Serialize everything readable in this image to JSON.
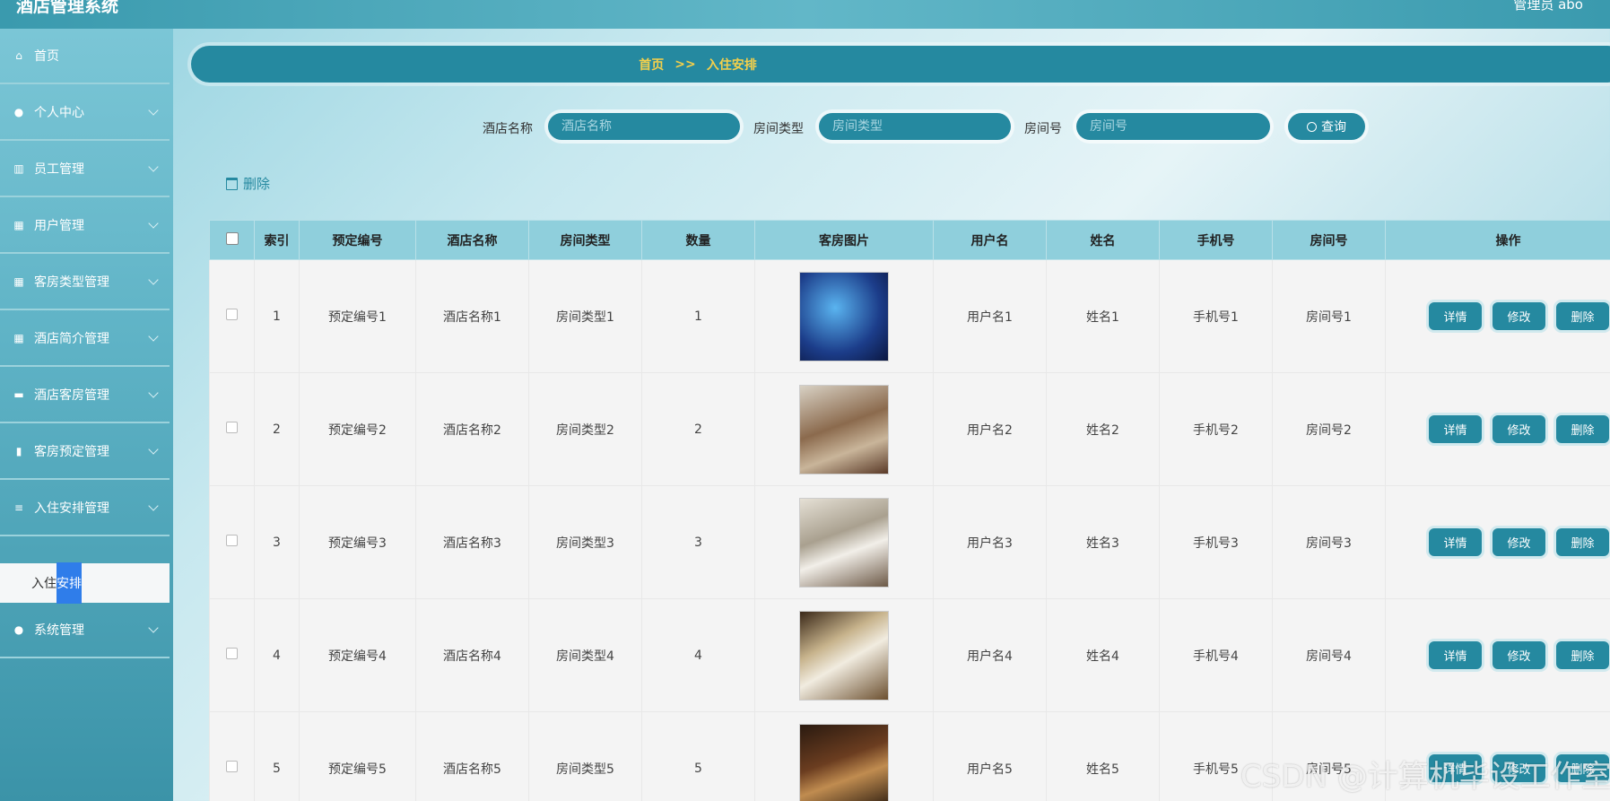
{
  "app": {
    "title": "酒店管理系统",
    "user": "管理员 abo"
  },
  "sidebar": {
    "items": [
      {
        "label": "首页",
        "icon": "home-icon"
      },
      {
        "label": "个人中心",
        "icon": "user-icon"
      },
      {
        "label": "员工管理",
        "icon": "bars-icon"
      },
      {
        "label": "用户管理",
        "icon": "grid-icon"
      },
      {
        "label": "客房类型管理",
        "icon": "grid-icon"
      },
      {
        "label": "酒店简介管理",
        "icon": "grid-icon"
      },
      {
        "label": "酒店客房管理",
        "icon": "comment-icon"
      },
      {
        "label": "客房预定管理",
        "icon": "bar-chart-icon"
      },
      {
        "label": "入住安排管理",
        "icon": "sliders-icon"
      },
      {
        "label": "系统管理",
        "icon": "user-icon"
      }
    ],
    "active_sub": {
      "prefix": "入住",
      "highlight": "安排"
    }
  },
  "breadcrumb": {
    "home": "首页",
    "sep": ">>",
    "current": "入住安排"
  },
  "search": {
    "hotel_label": "酒店名称",
    "hotel_placeholder": "酒店名称",
    "type_label": "房间类型",
    "type_placeholder": "房间类型",
    "room_label": "房间号",
    "room_placeholder": "房间号",
    "button": "查询"
  },
  "toolbar": {
    "delete": "删除"
  },
  "table": {
    "headers": [
      "索引",
      "预定编号",
      "酒店名称",
      "房间类型",
      "数量",
      "客房图片",
      "用户名",
      "姓名",
      "手机号",
      "房间号",
      "操作"
    ],
    "rows": [
      {
        "index": "1",
        "booking_no": "预定编号1",
        "hotel": "酒店名称1",
        "room_type": "房间类型1",
        "qty": "1",
        "username": "用户名1",
        "name": "姓名1",
        "phone": "手机号1",
        "room_no": "房间号1"
      },
      {
        "index": "2",
        "booking_no": "预定编号2",
        "hotel": "酒店名称2",
        "room_type": "房间类型2",
        "qty": "2",
        "username": "用户名2",
        "name": "姓名2",
        "phone": "手机号2",
        "room_no": "房间号2"
      },
      {
        "index": "3",
        "booking_no": "预定编号3",
        "hotel": "酒店名称3",
        "room_type": "房间类型3",
        "qty": "3",
        "username": "用户名3",
        "name": "姓名3",
        "phone": "手机号3",
        "room_no": "房间号3"
      },
      {
        "index": "4",
        "booking_no": "预定编号4",
        "hotel": "酒店名称4",
        "room_type": "房间类型4",
        "qty": "4",
        "username": "用户名4",
        "name": "姓名4",
        "phone": "手机号4",
        "room_no": "房间号4"
      },
      {
        "index": "5",
        "booking_no": "预定编号5",
        "hotel": "酒店名称5",
        "room_type": "房间类型5",
        "qty": "5",
        "username": "用户名5",
        "name": "姓名5",
        "phone": "手机号5",
        "room_no": "房间号5"
      }
    ],
    "actions": {
      "detail": "详情",
      "edit": "修改",
      "delete": "删除"
    }
  },
  "watermark": "CSDN @计算机毕设工作室",
  "colors": {
    "primary": "#2589a0",
    "breadcrumb_text": "#f5d04a",
    "header_bg": "#8fcfdc",
    "highlight": "#2f7dea"
  }
}
